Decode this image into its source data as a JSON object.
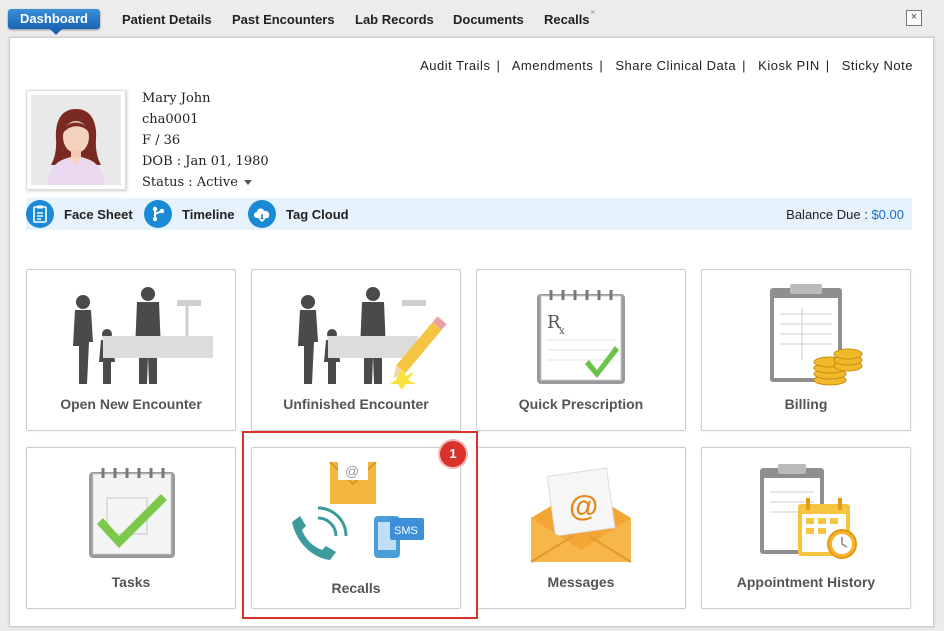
{
  "tabs": [
    "Dashboard",
    "Patient Details",
    "Past Encounters",
    "Lab Records",
    "Documents",
    "Recalls"
  ],
  "window": {
    "close": "×",
    "tab_close": "×"
  },
  "top_links": [
    "Audit Trails",
    "Amendments",
    "Share Clinical Data",
    "Kiosk PIN",
    "Sticky Note"
  ],
  "link_separator": "|",
  "patient": {
    "name": "Mary John",
    "id": "cha0001",
    "sex_age": "F / 36",
    "dob": "DOB : Jan 01, 1980",
    "status": "Status : Active"
  },
  "quick_actions": [
    {
      "label": "Face Sheet",
      "icon": "clipboard-icon"
    },
    {
      "label": "Timeline",
      "icon": "timeline-icon"
    },
    {
      "label": "Tag Cloud",
      "icon": "cloud-icon"
    }
  ],
  "balance": {
    "label": "Balance Due :",
    "amount": "$0.00"
  },
  "tiles": [
    {
      "label": "Open New Encounter",
      "icon": "doctor-family-icon"
    },
    {
      "label": "Unfinished Encounter",
      "icon": "doctor-family-pencil-icon"
    },
    {
      "label": "Quick Prescription",
      "icon": "prescription-pad-icon"
    },
    {
      "label": "Billing",
      "icon": "billing-icon"
    },
    {
      "label": "Tasks",
      "icon": "tasks-icon"
    },
    {
      "label": "Recalls",
      "icon": "recalls-icon"
    },
    {
      "label": "Messages",
      "icon": "messages-icon"
    },
    {
      "label": "Appointment History",
      "icon": "appointment-history-icon"
    }
  ],
  "recalls_badge": "1",
  "sms_label": "SMS",
  "rx_label": "R",
  "rx_sub": "x",
  "email_symbol": "@",
  "colors": {
    "accent": "#1a8ad6",
    "highlight": "#d8322a",
    "tab_active": "#1a63b5"
  }
}
